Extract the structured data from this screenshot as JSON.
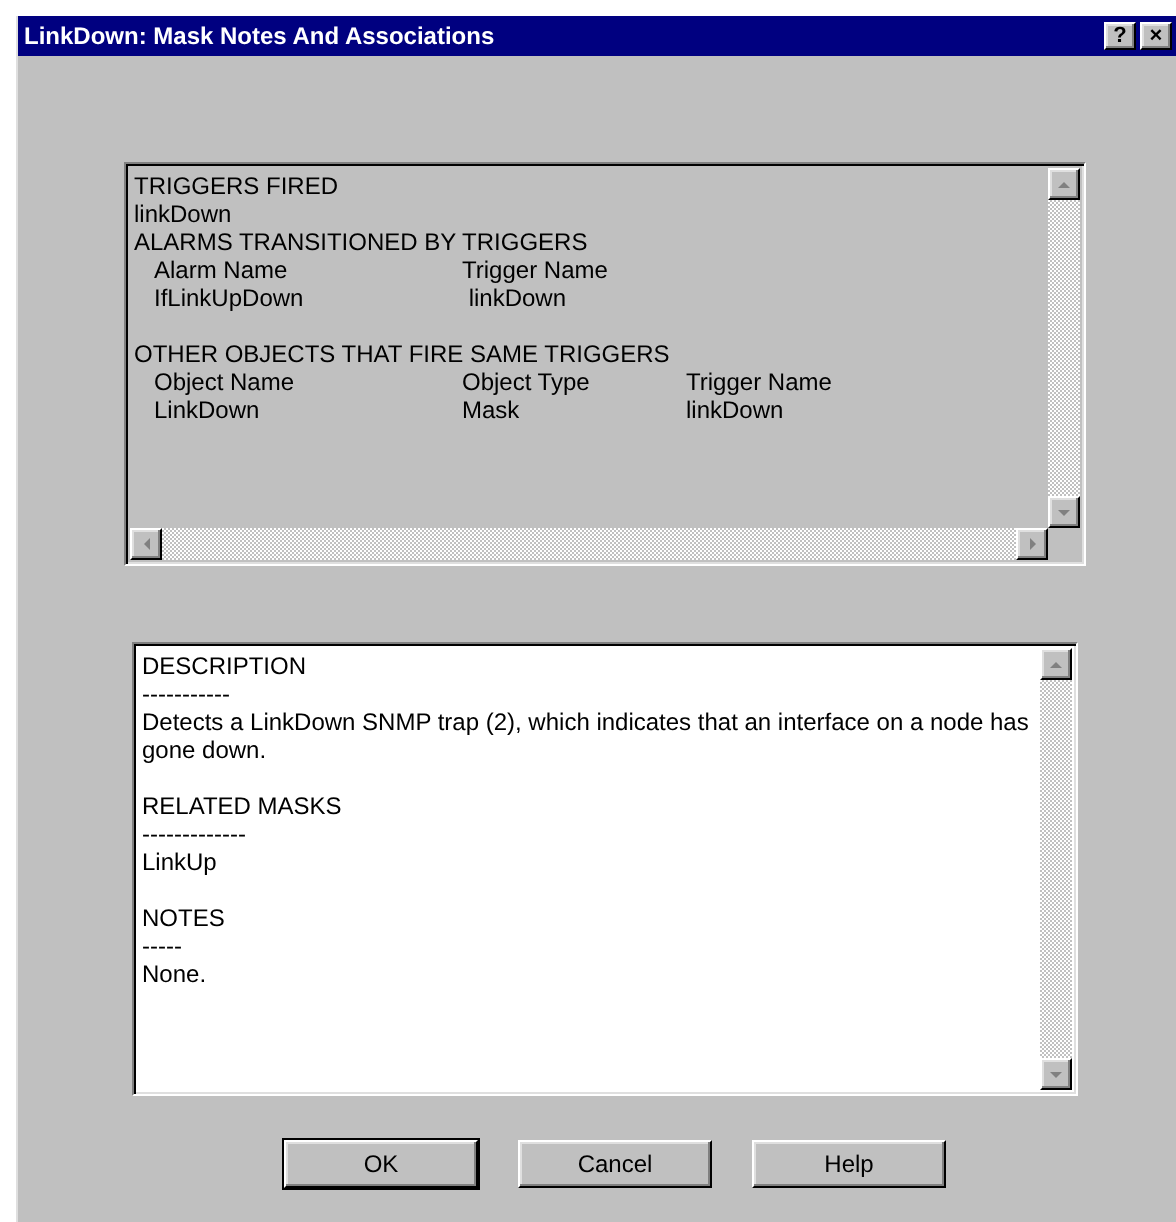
{
  "window": {
    "title": "LinkDown: Mask Notes And Associations",
    "title_buttons": [
      "?",
      "×"
    ]
  },
  "associations": {
    "lines": [
      {
        "kind": "text",
        "text": "TRIGGERS FIRED"
      },
      {
        "kind": "text",
        "text": "linkDown"
      },
      {
        "kind": "text",
        "text": "ALARMS TRANSITIONED BY TRIGGERS"
      },
      {
        "kind": "columns",
        "cells": [
          "Alarm Name",
          "Trigger Name"
        ]
      },
      {
        "kind": "columns",
        "cells": [
          "IfLinkUpDown",
          " linkDown"
        ]
      },
      {
        "kind": "blank"
      },
      {
        "kind": "text",
        "text": "OTHER OBJECTS THAT FIRE SAME TRIGGERS"
      },
      {
        "kind": "columns",
        "cells": [
          "Object Name",
          "Object Type",
          "Trigger Name"
        ]
      },
      {
        "kind": "columns",
        "cells": [
          "LinkDown",
          "Mask",
          "linkDown"
        ]
      }
    ]
  },
  "notes": {
    "lines": [
      {
        "kind": "text",
        "text": "DESCRIPTION"
      },
      {
        "kind": "text",
        "text": "-----------"
      },
      {
        "kind": "text",
        "text": "Detects a LinkDown SNMP trap (2), which indicates that an interface on a node has gone down."
      },
      {
        "kind": "blank"
      },
      {
        "kind": "text",
        "text": "RELATED MASKS"
      },
      {
        "kind": "text",
        "text": "-------------"
      },
      {
        "kind": "text",
        "text": "LinkUp"
      },
      {
        "kind": "blank"
      },
      {
        "kind": "text",
        "text": "NOTES"
      },
      {
        "kind": "text",
        "text": "-----"
      },
      {
        "kind": "text",
        "text": "None."
      }
    ]
  },
  "buttons": [
    {
      "label": "OK",
      "default": true
    },
    {
      "label": "Cancel",
      "default": false
    },
    {
      "label": "Help",
      "default": false
    }
  ]
}
